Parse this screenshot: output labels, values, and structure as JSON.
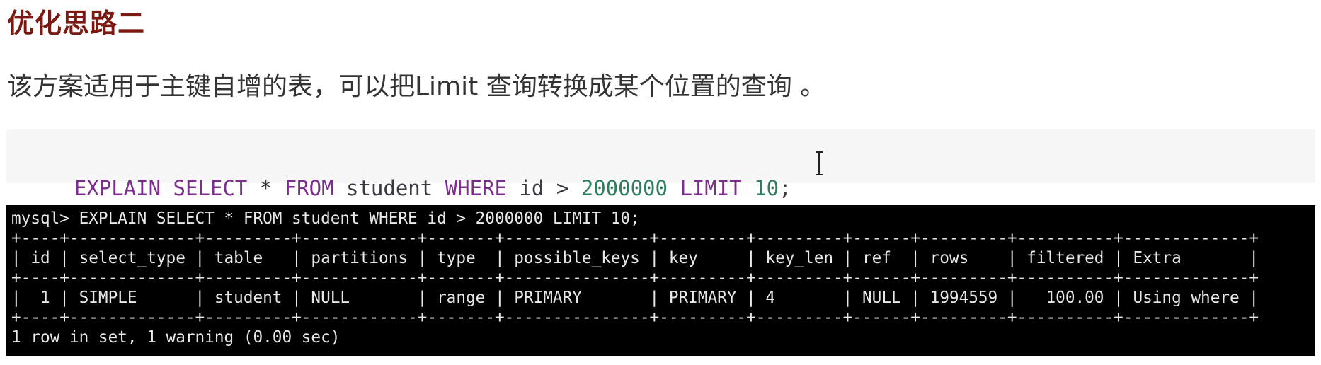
{
  "heading": "优化思路二",
  "paragraph": "该方案适用于主键自增的表，可以把Limit 查询转换成某个位置的查询 。",
  "code": {
    "tokens": [
      {
        "text": "EXPLAIN",
        "kind": "kw"
      },
      {
        "text": " ",
        "kind": "plain"
      },
      {
        "text": "SELECT",
        "kind": "kw"
      },
      {
        "text": " * ",
        "kind": "plain"
      },
      {
        "text": "FROM",
        "kind": "kw"
      },
      {
        "text": " student ",
        "kind": "plain"
      },
      {
        "text": "WHERE",
        "kind": "kw"
      },
      {
        "text": " id > ",
        "kind": "plain"
      },
      {
        "text": "2000000",
        "kind": "num"
      },
      {
        "text": " ",
        "kind": "plain"
      },
      {
        "text": "LIMIT",
        "kind": "kw"
      },
      {
        "text": " ",
        "kind": "plain"
      },
      {
        "text": "10",
        "kind": "num"
      },
      {
        "text": ";",
        "kind": "plain"
      }
    ],
    "colors": {
      "kw": "#7d2d8f",
      "num": "#2e7d5b",
      "plain": "#383a42"
    }
  },
  "terminal": {
    "command": "mysql> EXPLAIN SELECT * FROM student WHERE id > 2000000 LIMIT 10;",
    "border": "+----+-------------+---------+------------+-------+---------------+---------+---------+------+---------+----------+-------------+",
    "header": "| id | select_type | table   | partitions | type  | possible_keys | key     | key_len | ref  | rows    | filtered | Extra       |",
    "row": "|  1 | SIMPLE      | student | NULL       | range | PRIMARY       | PRIMARY | 4       | NULL | 1994559 |   100.00 | Using where |",
    "footer": "1 row in set, 1 warning (0.00 sec)",
    "background": "#000000",
    "foreground": "#e8e8e8"
  }
}
